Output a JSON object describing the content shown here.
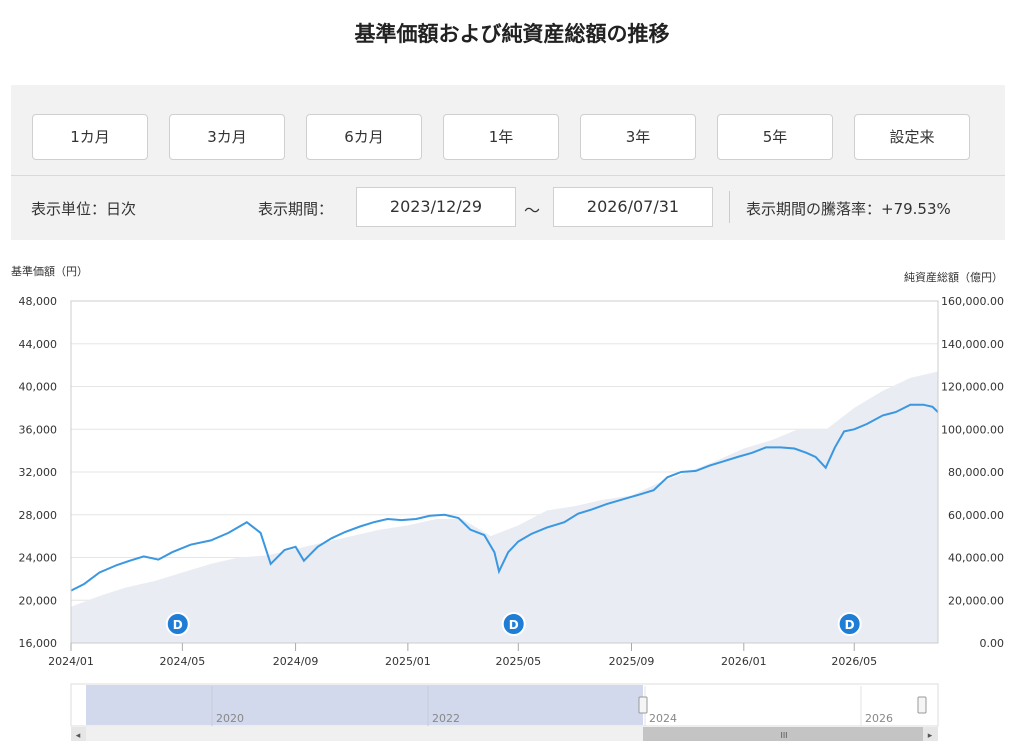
{
  "title": "基準価額および純資産総額の推移",
  "period_buttons": [
    "1カ月",
    "3カ月",
    "6カ月",
    "1年",
    "3年",
    "5年",
    "設定来"
  ],
  "display_unit_label": "表示単位：日次",
  "display_period_label": "表示期間：",
  "start_date": "2023/12/29",
  "tilde": "～",
  "end_date": "2026/07/31",
  "change_rate_label": "表示期間の騰落率：+79.53%",
  "navigator": {
    "year_labels": [
      "2020",
      "2022",
      "2024",
      "2026"
    ],
    "left_arrow": "◂",
    "right_arrow": "▸",
    "grip": "III"
  },
  "chart_data": {
    "type": "line",
    "left_axis_title": "基準価額（円）",
    "right_axis_title": "純資産総額（億円）",
    "left_ylim": [
      16000,
      48000
    ],
    "left_ticks": [
      "48,000",
      "44,000",
      "40,000",
      "36,000",
      "32,000",
      "28,000",
      "24,000",
      "20,000",
      "16,000"
    ],
    "right_ylim": [
      0,
      160000
    ],
    "right_ticks": [
      "160,000.00",
      "140,000.00",
      "120,000.00",
      "100,000.00",
      "80,000.00",
      "60,000.00",
      "40,000.00",
      "20,000.00",
      "0.00"
    ],
    "x_ticks": [
      "2024/01",
      "2024/05",
      "2024/09",
      "2025/01",
      "2025/05",
      "2025/09",
      "2026/01",
      "2026/05"
    ],
    "grid": true,
    "dividend_marker_label": "D",
    "dividend_markers": [
      "2024/04",
      "2025/04",
      "2026/04"
    ],
    "nav_series": [
      [
        "2024/01/01",
        20900
      ],
      [
        "2024/01/15",
        21500
      ],
      [
        "2024/02/01",
        22600
      ],
      [
        "2024/02/20",
        23300
      ],
      [
        "2024/03/05",
        23700
      ],
      [
        "2024/03/20",
        24100
      ],
      [
        "2024/04/05",
        23800
      ],
      [
        "2024/04/20",
        24500
      ],
      [
        "2024/05/10",
        25200
      ],
      [
        "2024/06/01",
        25600
      ],
      [
        "2024/06/20",
        26300
      ],
      [
        "2024/07/10",
        27300
      ],
      [
        "2024/07/25",
        26300
      ],
      [
        "2024/08/05",
        23400
      ],
      [
        "2024/08/20",
        24700
      ],
      [
        "2024/09/01",
        25000
      ],
      [
        "2024/09/10",
        23700
      ],
      [
        "2024/09/25",
        25000
      ],
      [
        "2024/10/10",
        25800
      ],
      [
        "2024/10/25",
        26400
      ],
      [
        "2024/11/10",
        26900
      ],
      [
        "2024/11/25",
        27300
      ],
      [
        "2024/12/10",
        27600
      ],
      [
        "2024/12/25",
        27500
      ],
      [
        "2025/01/10",
        27600
      ],
      [
        "2025/01/25",
        27900
      ],
      [
        "2025/02/10",
        28000
      ],
      [
        "2025/02/25",
        27700
      ],
      [
        "2025/03/10",
        26600
      ],
      [
        "2025/03/25",
        26100
      ],
      [
        "2025/04/05",
        24500
      ],
      [
        "2025/04/10",
        22700
      ],
      [
        "2025/04/20",
        24500
      ],
      [
        "2025/05/01",
        25500
      ],
      [
        "2025/05/15",
        26200
      ],
      [
        "2025/06/01",
        26800
      ],
      [
        "2025/06/20",
        27300
      ],
      [
        "2025/07/05",
        28100
      ],
      [
        "2025/07/20",
        28500
      ],
      [
        "2025/08/05",
        29000
      ],
      [
        "2025/08/25",
        29500
      ],
      [
        "2025/09/10",
        29900
      ],
      [
        "2025/09/25",
        30300
      ],
      [
        "2025/10/10",
        31500
      ],
      [
        "2025/10/25",
        32000
      ],
      [
        "2025/11/10",
        32100
      ],
      [
        "2025/11/25",
        32600
      ],
      [
        "2025/12/10",
        33000
      ],
      [
        "2025/12/25",
        33400
      ],
      [
        "2026/01/10",
        33800
      ],
      [
        "2026/01/25",
        34300
      ],
      [
        "2026/02/10",
        34300
      ],
      [
        "2026/02/25",
        34200
      ],
      [
        "2026/03/10",
        33800
      ],
      [
        "2026/03/20",
        33400
      ],
      [
        "2026/03/31",
        32400
      ],
      [
        "2026/04/10",
        34300
      ],
      [
        "2026/04/20",
        35800
      ],
      [
        "2026/05/01",
        36000
      ],
      [
        "2026/05/15",
        36500
      ],
      [
        "2026/06/01",
        37300
      ],
      [
        "2026/06/15",
        37600
      ],
      [
        "2026/07/01",
        38300
      ],
      [
        "2026/07/15",
        38300
      ],
      [
        "2026/07/25",
        38100
      ],
      [
        "2026/07/31",
        37600
      ]
    ],
    "aum_series": [
      [
        "2024/01/01",
        17000
      ],
      [
        "2024/02/01",
        22000
      ],
      [
        "2024/03/01",
        26000
      ],
      [
        "2024/04/01",
        29000
      ],
      [
        "2024/05/01",
        33000
      ],
      [
        "2024/06/01",
        37000
      ],
      [
        "2024/07/01",
        40000
      ],
      [
        "2024/08/01",
        41000
      ],
      [
        "2024/09/01",
        44000
      ],
      [
        "2024/10/01",
        47000
      ],
      [
        "2024/11/01",
        50000
      ],
      [
        "2024/12/01",
        53000
      ],
      [
        "2025/01/01",
        55000
      ],
      [
        "2025/02/01",
        58000
      ],
      [
        "2025/03/01",
        58000
      ],
      [
        "2025/04/01",
        50000
      ],
      [
        "2025/05/01",
        55000
      ],
      [
        "2025/06/01",
        62000
      ],
      [
        "2025/07/01",
        64000
      ],
      [
        "2025/08/01",
        67000
      ],
      [
        "2025/09/01",
        69000
      ],
      [
        "2025/10/01",
        75000
      ],
      [
        "2025/11/01",
        80000
      ],
      [
        "2025/12/01",
        85000
      ],
      [
        "2026/01/01",
        91000
      ],
      [
        "2026/02/01",
        95000
      ],
      [
        "2026/03/01",
        100000
      ],
      [
        "2026/04/01",
        100000
      ],
      [
        "2026/05/01",
        110000
      ],
      [
        "2026/06/01",
        118000
      ],
      [
        "2026/07/01",
        124000
      ],
      [
        "2026/07/31",
        127000
      ]
    ]
  }
}
